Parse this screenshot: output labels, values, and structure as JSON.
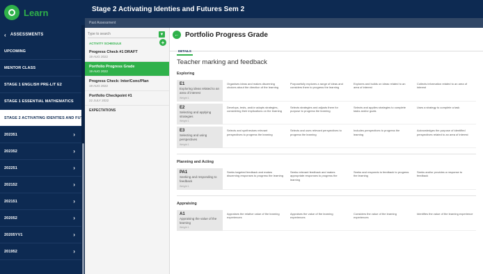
{
  "app": {
    "name": "Learn"
  },
  "sidebar": {
    "back_label": "ASSESSMENTS",
    "items": [
      {
        "label": "UPCOMING",
        "arrow": false,
        "active": false
      },
      {
        "label": "MENTOR CLASS",
        "arrow": false,
        "active": false
      },
      {
        "label": "STAGE 1 ENGLISH PRE-LIT E2",
        "arrow": false,
        "active": false
      },
      {
        "label": "STAGE 1 ESSENTIAL MATHEMATICS",
        "arrow": false,
        "active": false
      },
      {
        "label": "STAGE 2 ACTIVATING IDENTIES AND FUTURES",
        "arrow": false,
        "active": true
      },
      {
        "label": "202351",
        "arrow": true,
        "active": false
      },
      {
        "label": "202352",
        "arrow": true,
        "active": false
      },
      {
        "label": "202251",
        "arrow": true,
        "active": false
      },
      {
        "label": "202152",
        "arrow": true,
        "active": false
      },
      {
        "label": "202151",
        "arrow": true,
        "active": false
      },
      {
        "label": "202052",
        "arrow": true,
        "active": false
      },
      {
        "label": "20205YV1",
        "arrow": true,
        "active": false
      },
      {
        "label": "201952",
        "arrow": true,
        "active": false
      }
    ]
  },
  "header": {
    "title": "Stage 2 Activating Identies and Futures Sem 2",
    "subtitle": "Past Assessment"
  },
  "list": {
    "search_placeholder": "Type to search",
    "sort_label": "ACTIVITY SCHEDULE",
    "items": [
      {
        "title": "Progress Check #1 DRAFT",
        "date": "19 AUG 2022",
        "selected": false
      },
      {
        "title": "Portfolio Progress Grade",
        "date": "19 AUG 2022",
        "selected": true
      },
      {
        "title": "Progress Check: Inter/Conc/Plan",
        "date": "19 AUG 2022",
        "selected": false
      },
      {
        "title": "Portfolio Checkpoint #1",
        "date": "22 JULY 2022",
        "selected": false
      }
    ],
    "section_label": "EXPECTATIONS"
  },
  "main": {
    "title": "Portfolio Progress Grade",
    "tab_label": "DETAILS",
    "section_title": "Teacher marking and feedback",
    "groups": [
      {
        "title": "Exploring",
        "rows": [
          {
            "code": "E1",
            "name": "Exploring ideas related to an area of interest",
            "weight": "Weight 1",
            "levels": [
              "Organises ideas and makes discerning choices about the direction of the learning",
              "Purposefully explores a range of ideas and considers them to progress the learning",
              "Explores and builds on ideas related to an area of interest",
              "Collects information related to an area of interest"
            ]
          },
          {
            "code": "E2",
            "name": "Selecting and applying strategies",
            "weight": "Weight 1",
            "levels": [
              "Develops, tests, and/or adapts strategies, considering their implications on the learning",
              "Selects strategies and adjusts them for purpose to progress the learning",
              "Selects and applies strategies to complete tasks and/or goals",
              "Uses a strategy to complete a task"
            ]
          },
          {
            "code": "E3",
            "name": "Selecting and using perspectives",
            "weight": "Weight 1",
            "levels": [
              "Selects and synthesises relevant perspectives to progress the learning",
              "Selects and uses relevant perspectives to progress the learning",
              "Includes perspectives to progress the learning",
              "Acknowledges the purpose of identified perspectives related to an area of interest"
            ]
          }
        ]
      },
      {
        "title": "Planning and Acting",
        "rows": [
          {
            "code": "PA1",
            "name": "Seeking and responding to feedback",
            "weight": "Weight 1",
            "levels": [
              "Seeks targeted feedback and makes discerning responses to progress the learning",
              "Seeks relevant feedback and makes appropriate responses to progress the learning",
              "Seeks and responds to feedback to progress the learning",
              "Seeks and/or provides a response to feedback"
            ]
          }
        ]
      },
      {
        "title": "Appraising",
        "rows": [
          {
            "code": "A1",
            "name": "Appraising the value of the learning",
            "weight": "Weight 1",
            "levels": [
              "Appraises the relative value of the learning experiences",
              "Appraises the value of the learning experiences",
              "Considers the value of the learning experiences",
              "Identifies the value of the learning experience"
            ]
          }
        ]
      }
    ]
  },
  "colors": {
    "navy": "#0d2a52",
    "accent_green": "#2fb14a"
  },
  "icons": {
    "brand": "learn-logo-icon",
    "back": "chevron-left-icon",
    "nav_arrow": "chevron-right-icon",
    "filter": "filter-icon",
    "add": "add-icon",
    "main_back": "arrow-left-icon"
  }
}
